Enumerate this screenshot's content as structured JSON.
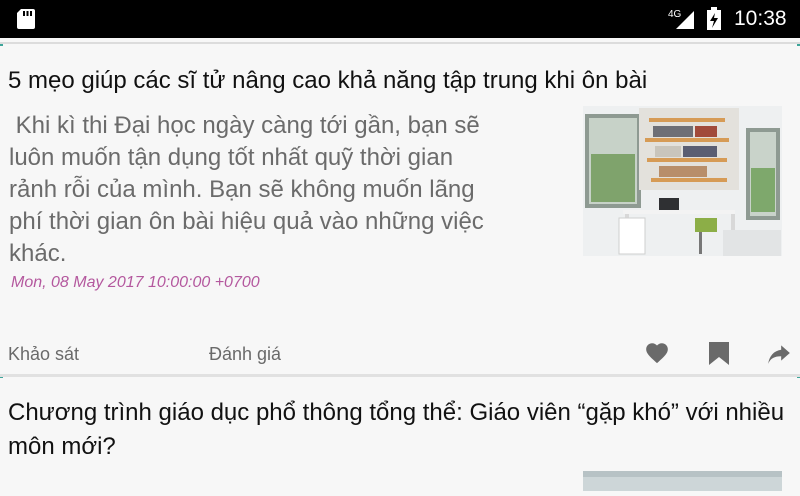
{
  "status": {
    "network": "4G",
    "time": "10:38"
  },
  "articles": [
    {
      "title": "5 mẹo giúp các sĩ tử nâng cao khả năng tập trung khi ôn bài",
      "summary": " Khi kì thi Đại học ngày càng tới gần, bạn sẽ\nluôn muốn tận dụng tốt nhất quỹ thời gian\nrảnh rỗi của mình. Bạn sẽ không muốn lãng\nphí thời gian ôn bài hiệu quả vào những việc\nkhác.",
      "date": "Mon, 08 May 2017 10:00:00 +0700",
      "actions": {
        "survey_label": "Khảo sát",
        "rate_label": "Đánh giá"
      },
      "thumb_icon": "study-room-photo"
    },
    {
      "title": "Chương trình giáo dục phổ thông tổng thể: Giáo viên “gặp khó” với nhiều môn mới?",
      "thumb_icon": "article-photo"
    }
  ],
  "icons": {
    "sd": "sd-card-icon",
    "heart": "heart-icon",
    "bookmark": "bookmark-icon",
    "share": "share-icon"
  },
  "colors": {
    "date": "#b4589e",
    "accent": "#3ea59a",
    "text": "#111111",
    "summary": "#6b6b6b"
  }
}
